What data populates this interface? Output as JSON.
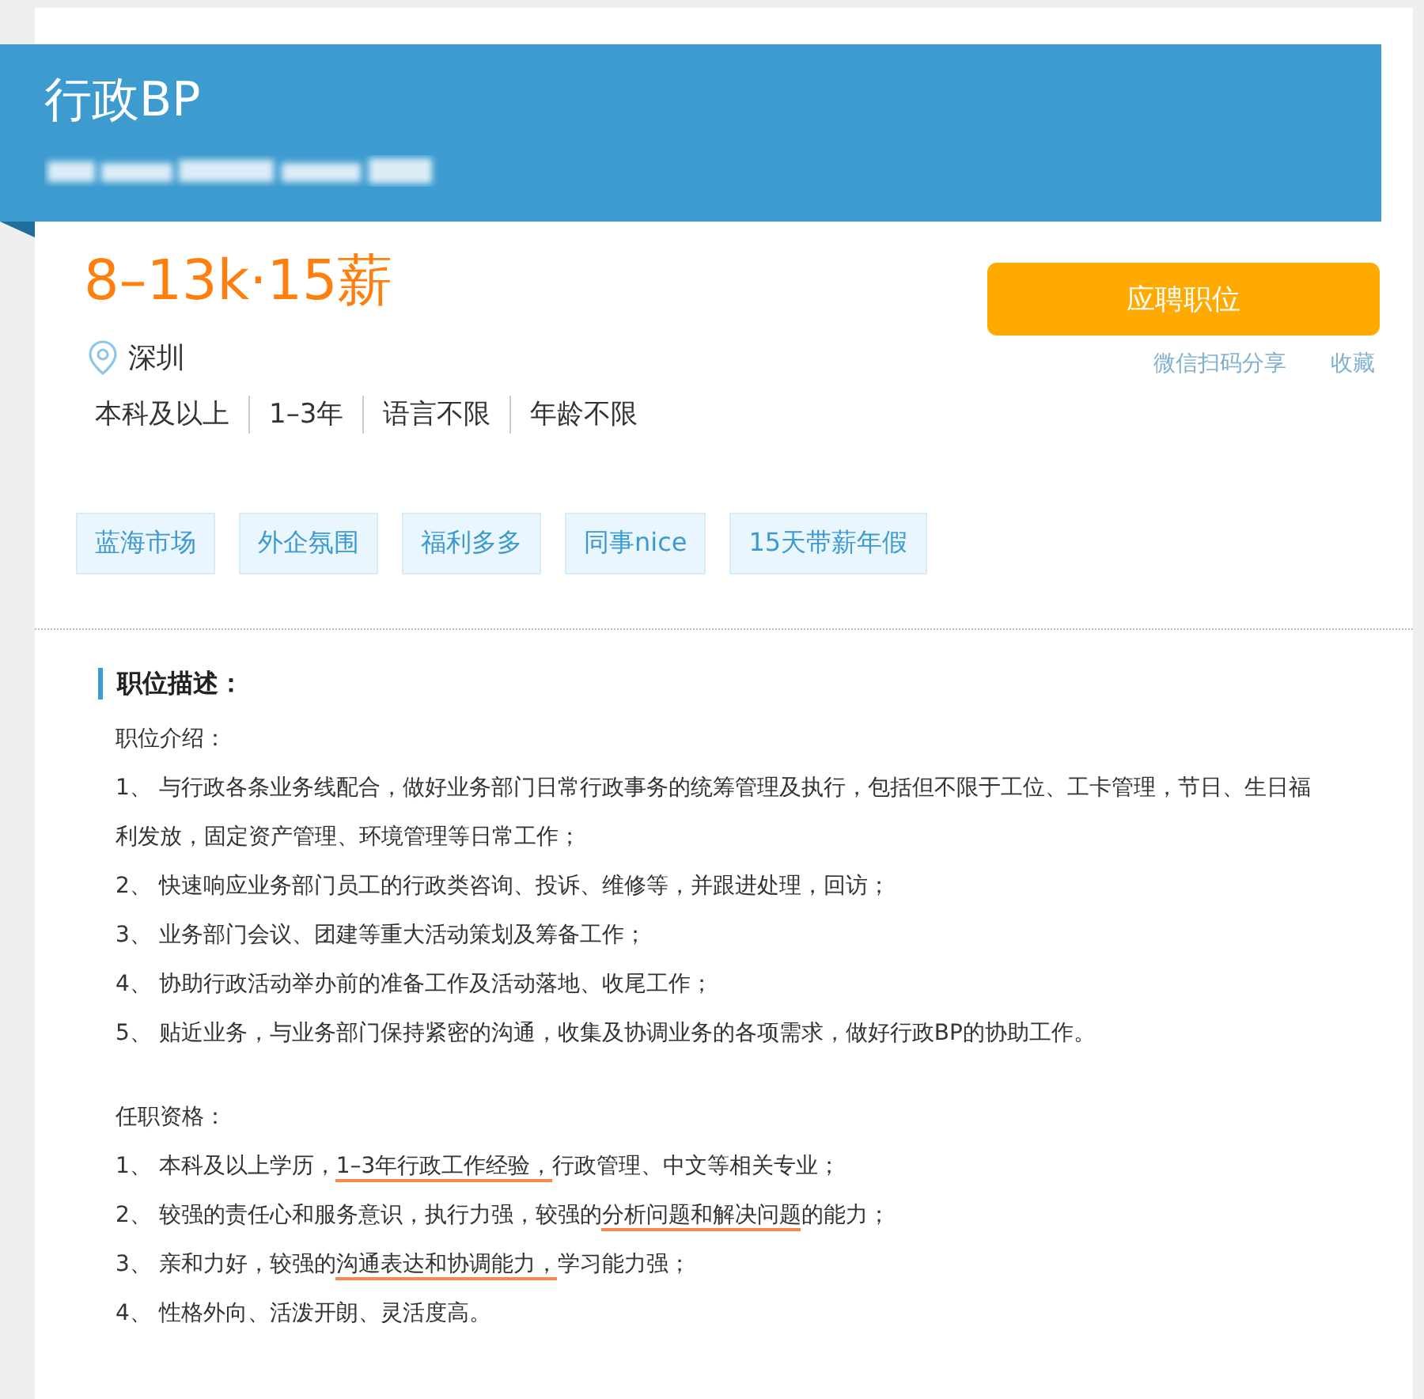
{
  "header": {
    "title": "行政BP",
    "company_redacted": true
  },
  "salary": "8–13k·15薪",
  "apply_button": "应聘职位",
  "links": [
    "微信扫码分享",
    "收藏"
  ],
  "location": "深圳",
  "requirements": [
    "本科及以上",
    "1–3年",
    "语言不限",
    "年龄不限"
  ],
  "tags": [
    "蓝海市场",
    "外企氛围",
    "福利多多",
    "同事nice",
    "15天带薪年假"
  ],
  "description": {
    "title": "职位描述：",
    "sections": [
      {
        "heading": "职位介绍：",
        "lines": [
          {
            "parts": [
              {
                "text": "1、 与行政各条业务线配合，做好业务部门日常行政事务的统筹管理及执行，包括但不限于工位、工卡管理，节日、生日福利发放，固定资产管理、环境管理等日常工作；",
                "underlined": false
              }
            ]
          },
          {
            "parts": [
              {
                "text": "2、 快速响应业务部门员工的行政类咨询、投诉、维修等，并跟进处理，回访；",
                "underlined": false
              }
            ]
          },
          {
            "parts": [
              {
                "text": "3、 业务部门会议、团建等重大活动策划及筹备工作；",
                "underlined": false
              }
            ]
          },
          {
            "parts": [
              {
                "text": "4、 协助行政活动举办前的准备工作及活动落地、收尾工作；",
                "underlined": false
              }
            ]
          },
          {
            "parts": [
              {
                "text": "5、 贴近业务，与业务部门保持紧密的沟通，收集及协调业务的各项需求，做好行政BP的协助工作。",
                "underlined": false
              }
            ]
          }
        ]
      },
      {
        "heading": "任职资格：",
        "lines": [
          {
            "parts": [
              {
                "text": "1、 本科及以上学历，",
                "underlined": false
              },
              {
                "text": "1–3年行政工作经验，",
                "underlined": true
              },
              {
                "text": "行政管理、中文等相关专业；",
                "underlined": false
              }
            ]
          },
          {
            "parts": [
              {
                "text": "2、 较强的责任心和服务意识，执行力强，较强的",
                "underlined": false
              },
              {
                "text": "分析问题和解决问题",
                "underlined": true
              },
              {
                "text": "的能力；",
                "underlined": false
              }
            ]
          },
          {
            "parts": [
              {
                "text": "3、 亲和力好，较强的",
                "underlined": false
              },
              {
                "text": "沟通表达和协调能力，",
                "underlined": true
              },
              {
                "text": "学习能力强；",
                "underlined": false
              }
            ]
          },
          {
            "parts": [
              {
                "text": "4、 性格外向、活泼开朗、灵活度高。",
                "underlined": false
              }
            ]
          }
        ]
      }
    ]
  }
}
